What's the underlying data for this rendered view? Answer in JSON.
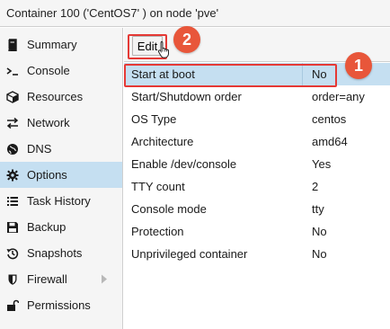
{
  "window": {
    "title": "Container 100 ('CentOS7' ) on node 'pve'"
  },
  "sidebar": {
    "items": [
      {
        "label": "Summary",
        "icon": "book-icon",
        "active": false
      },
      {
        "label": "Console",
        "icon": "terminal-icon",
        "active": false
      },
      {
        "label": "Resources",
        "icon": "cube-icon",
        "active": false
      },
      {
        "label": "Network",
        "icon": "exchange-icon",
        "active": false
      },
      {
        "label": "DNS",
        "icon": "globe-icon",
        "active": false
      },
      {
        "label": "Options",
        "icon": "gear-icon",
        "active": true
      },
      {
        "label": "Task History",
        "icon": "list-icon",
        "active": false
      },
      {
        "label": "Backup",
        "icon": "floppy-disk-icon",
        "active": false
      },
      {
        "label": "Snapshots",
        "icon": "history-icon",
        "active": false
      },
      {
        "label": "Firewall",
        "icon": "shield-icon",
        "active": false,
        "has_submenu": true
      },
      {
        "label": "Permissions",
        "icon": "unlock-icon",
        "active": false
      }
    ]
  },
  "toolbar": {
    "edit_label": "Edit"
  },
  "annotations": {
    "step_1": "1",
    "step_2": "2",
    "color": "#e53935",
    "badge_color": "#e8563a"
  },
  "options": {
    "rows": [
      {
        "key": "Start at boot",
        "value": "No",
        "selected": true
      },
      {
        "key": "Start/Shutdown order",
        "value": "order=any"
      },
      {
        "key": "OS Type",
        "value": "centos"
      },
      {
        "key": "Architecture",
        "value": "amd64"
      },
      {
        "key": "Enable /dev/console",
        "value": "Yes"
      },
      {
        "key": "TTY count",
        "value": "2"
      },
      {
        "key": "Console mode",
        "value": "tty"
      },
      {
        "key": "Protection",
        "value": "No"
      },
      {
        "key": "Unprivileged container",
        "value": "No"
      }
    ]
  },
  "colors": {
    "selection": "#c5dff1",
    "panel_bg": "#f5f5f5"
  }
}
